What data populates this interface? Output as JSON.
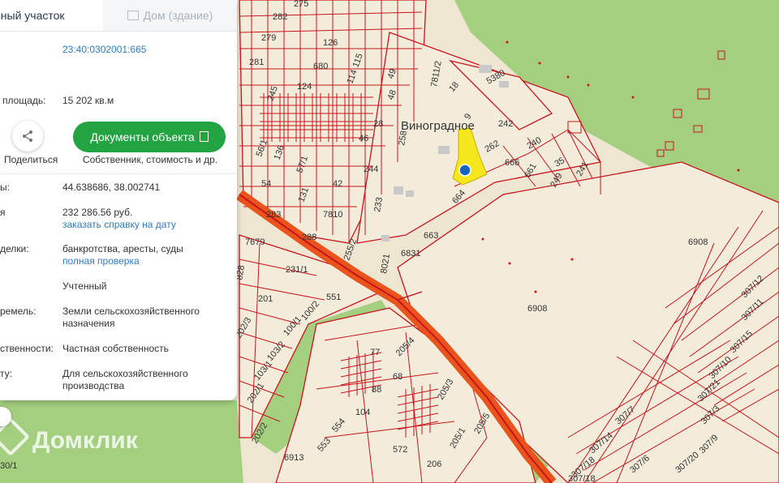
{
  "tabs": {
    "land": "ельный участок",
    "building": "Дом (здание)"
  },
  "info": {
    "cadastral_number": "23:40:0302001:665",
    "area_label": "площадь:",
    "area_value": "15 202 кв.м",
    "share_label": "Поделиться",
    "documents_button": "Документы объекта",
    "documents_sub": "Собственник, стоимость и др.",
    "coords_label": "ы:",
    "coords_value": "44.638686, 38.002741",
    "cost_label": "я",
    "cost_value": "232 286.56 руб.",
    "cost_link": "заказать справку на дату",
    "deals_label": "делки:",
    "deals_value": "банкротства, аресты, суды",
    "deals_link": "полная проверка",
    "status_value": "Учтенный",
    "category_label": "ремель:",
    "category_value": "Земли сельскохозяйственного назначения",
    "ownership_label": "ственности:",
    "ownership_value": "Частная собственность",
    "usage_label": "ту:",
    "usage_value": "Для сельскохозяйственного производства"
  },
  "map": {
    "settlement": "Виноградное",
    "watermark": "Домклик",
    "parcel_labels": [
      "275",
      "282",
      "279",
      "126",
      "281",
      "680",
      "115",
      "49",
      "114",
      "48",
      "124",
      "245",
      "28",
      "46",
      "56/1",
      "136",
      "57/1",
      "244",
      "42",
      "54",
      "131",
      "7810",
      "283",
      "288",
      "7679",
      "231/1",
      "255/2",
      "828",
      "201",
      "551",
      "100/2",
      "202/3",
      "100/1",
      "103/2",
      "103/1",
      "202/1",
      "202/2",
      "553",
      "554",
      "104",
      "572",
      "206",
      "205/1",
      "205/5",
      "205/3",
      "205/4",
      "77",
      "68",
      "88",
      "6913",
      "30/1",
      "7811/2",
      "18",
      "5380",
      "242",
      "9",
      "262",
      "240",
      "666",
      "35",
      "661",
      "249",
      "241",
      "664",
      "663",
      "6831",
      "8021",
      "233",
      "258",
      "6908",
      "6908",
      "307/11",
      "307/12",
      "307/15",
      "307/10",
      "307/21",
      "307/3",
      "307/9",
      "307/7",
      "307/14",
      "307/18",
      "307/6",
      "307/20",
      "307/18"
    ]
  },
  "colors": {
    "parcel_border": "#c8141e",
    "parcel_fill": "#f4ecdb",
    "forest": "#a4cf7f",
    "highway": "#e8541c",
    "selected_parcel": "#f5e61e",
    "marker": "#1565c0",
    "accent_green": "#23a443",
    "link": "#2f7bbf"
  }
}
